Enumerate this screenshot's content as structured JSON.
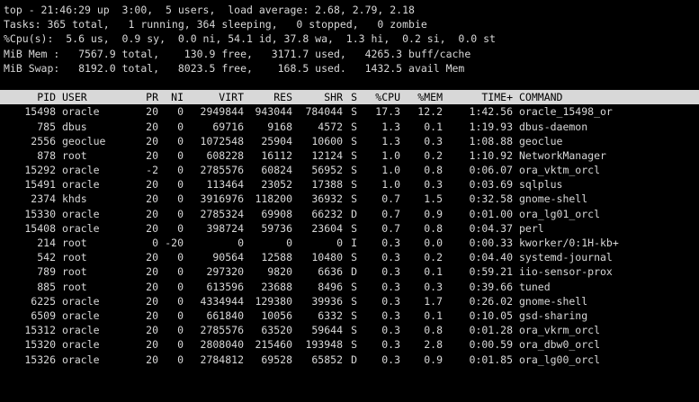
{
  "summary": {
    "line1": "top - 21:46:29 up  3:00,  5 users,  load average: 2.68, 2.79, 2.18",
    "line2": "Tasks: 365 total,   1 running, 364 sleeping,   0 stopped,   0 zombie",
    "line3": "%Cpu(s):  5.6 us,  0.9 sy,  0.0 ni, 54.1 id, 37.8 wa,  1.3 hi,  0.2 si,  0.0 st",
    "line4": "MiB Mem :   7567.9 total,    130.9 free,   3171.7 used,   4265.3 buff/cache",
    "line5": "MiB Swap:   8192.0 total,   8023.5 free,    168.5 used.   1432.5 avail Mem"
  },
  "columns": {
    "pid": "PID",
    "user": "USER",
    "pr": "PR",
    "ni": "NI",
    "virt": "VIRT",
    "res": "RES",
    "shr": "SHR",
    "s": "S",
    "cpu": "%CPU",
    "mem": "%MEM",
    "time": "TIME+",
    "command": "COMMAND"
  },
  "processes": [
    {
      "pid": "15498",
      "user": "oracle",
      "pr": "20",
      "ni": "0",
      "virt": "2949844",
      "res": "943044",
      "shr": "784044",
      "s": "S",
      "cpu": "17.3",
      "mem": "12.2",
      "time": "1:42.56",
      "command": "oracle_15498_or"
    },
    {
      "pid": "785",
      "user": "dbus",
      "pr": "20",
      "ni": "0",
      "virt": "69716",
      "res": "9168",
      "shr": "4572",
      "s": "S",
      "cpu": "1.3",
      "mem": "0.1",
      "time": "1:19.93",
      "command": "dbus-daemon"
    },
    {
      "pid": "2556",
      "user": "geoclue",
      "pr": "20",
      "ni": "0",
      "virt": "1072548",
      "res": "25904",
      "shr": "10600",
      "s": "S",
      "cpu": "1.3",
      "mem": "0.3",
      "time": "1:08.88",
      "command": "geoclue"
    },
    {
      "pid": "878",
      "user": "root",
      "pr": "20",
      "ni": "0",
      "virt": "608228",
      "res": "16112",
      "shr": "12124",
      "s": "S",
      "cpu": "1.0",
      "mem": "0.2",
      "time": "1:10.92",
      "command": "NetworkManager"
    },
    {
      "pid": "15292",
      "user": "oracle",
      "pr": "-2",
      "ni": "0",
      "virt": "2785576",
      "res": "60824",
      "shr": "56952",
      "s": "S",
      "cpu": "1.0",
      "mem": "0.8",
      "time": "0:06.07",
      "command": "ora_vktm_orcl"
    },
    {
      "pid": "15491",
      "user": "oracle",
      "pr": "20",
      "ni": "0",
      "virt": "113464",
      "res": "23052",
      "shr": "17388",
      "s": "S",
      "cpu": "1.0",
      "mem": "0.3",
      "time": "0:03.69",
      "command": "sqlplus"
    },
    {
      "pid": "2374",
      "user": "khds",
      "pr": "20",
      "ni": "0",
      "virt": "3916976",
      "res": "118200",
      "shr": "36932",
      "s": "S",
      "cpu": "0.7",
      "mem": "1.5",
      "time": "0:32.58",
      "command": "gnome-shell"
    },
    {
      "pid": "15330",
      "user": "oracle",
      "pr": "20",
      "ni": "0",
      "virt": "2785324",
      "res": "69908",
      "shr": "66232",
      "s": "D",
      "cpu": "0.7",
      "mem": "0.9",
      "time": "0:01.00",
      "command": "ora_lg01_orcl"
    },
    {
      "pid": "15408",
      "user": "oracle",
      "pr": "20",
      "ni": "0",
      "virt": "398724",
      "res": "59736",
      "shr": "23604",
      "s": "S",
      "cpu": "0.7",
      "mem": "0.8",
      "time": "0:04.37",
      "command": "perl"
    },
    {
      "pid": "214",
      "user": "root",
      "pr": "0",
      "ni": "-20",
      "virt": "0",
      "res": "0",
      "shr": "0",
      "s": "I",
      "cpu": "0.3",
      "mem": "0.0",
      "time": "0:00.33",
      "command": "kworker/0:1H-kb+"
    },
    {
      "pid": "542",
      "user": "root",
      "pr": "20",
      "ni": "0",
      "virt": "90564",
      "res": "12588",
      "shr": "10480",
      "s": "S",
      "cpu": "0.3",
      "mem": "0.2",
      "time": "0:04.40",
      "command": "systemd-journal"
    },
    {
      "pid": "789",
      "user": "root",
      "pr": "20",
      "ni": "0",
      "virt": "297320",
      "res": "9820",
      "shr": "6636",
      "s": "D",
      "cpu": "0.3",
      "mem": "0.1",
      "time": "0:59.21",
      "command": "iio-sensor-prox"
    },
    {
      "pid": "885",
      "user": "root",
      "pr": "20",
      "ni": "0",
      "virt": "613596",
      "res": "23688",
      "shr": "8496",
      "s": "S",
      "cpu": "0.3",
      "mem": "0.3",
      "time": "0:39.66",
      "command": "tuned"
    },
    {
      "pid": "6225",
      "user": "oracle",
      "pr": "20",
      "ni": "0",
      "virt": "4334944",
      "res": "129380",
      "shr": "39936",
      "s": "S",
      "cpu": "0.3",
      "mem": "1.7",
      "time": "0:26.02",
      "command": "gnome-shell"
    },
    {
      "pid": "6509",
      "user": "oracle",
      "pr": "20",
      "ni": "0",
      "virt": "661840",
      "res": "10056",
      "shr": "6332",
      "s": "S",
      "cpu": "0.3",
      "mem": "0.1",
      "time": "0:10.05",
      "command": "gsd-sharing"
    },
    {
      "pid": "15312",
      "user": "oracle",
      "pr": "20",
      "ni": "0",
      "virt": "2785576",
      "res": "63520",
      "shr": "59644",
      "s": "S",
      "cpu": "0.3",
      "mem": "0.8",
      "time": "0:01.28",
      "command": "ora_vkrm_orcl"
    },
    {
      "pid": "15320",
      "user": "oracle",
      "pr": "20",
      "ni": "0",
      "virt": "2808040",
      "res": "215460",
      "shr": "193948",
      "s": "S",
      "cpu": "0.3",
      "mem": "2.8",
      "time": "0:00.59",
      "command": "ora_dbw0_orcl"
    },
    {
      "pid": "15326",
      "user": "oracle",
      "pr": "20",
      "ni": "0",
      "virt": "2784812",
      "res": "69528",
      "shr": "65852",
      "s": "D",
      "cpu": "0.3",
      "mem": "0.9",
      "time": "0:01.85",
      "command": "ora_lg00_orcl"
    }
  ],
  "colors": {
    "background": "#000000",
    "foreground": "#d8d8d8",
    "header_bg": "#d8d8d8",
    "header_fg": "#000000"
  }
}
